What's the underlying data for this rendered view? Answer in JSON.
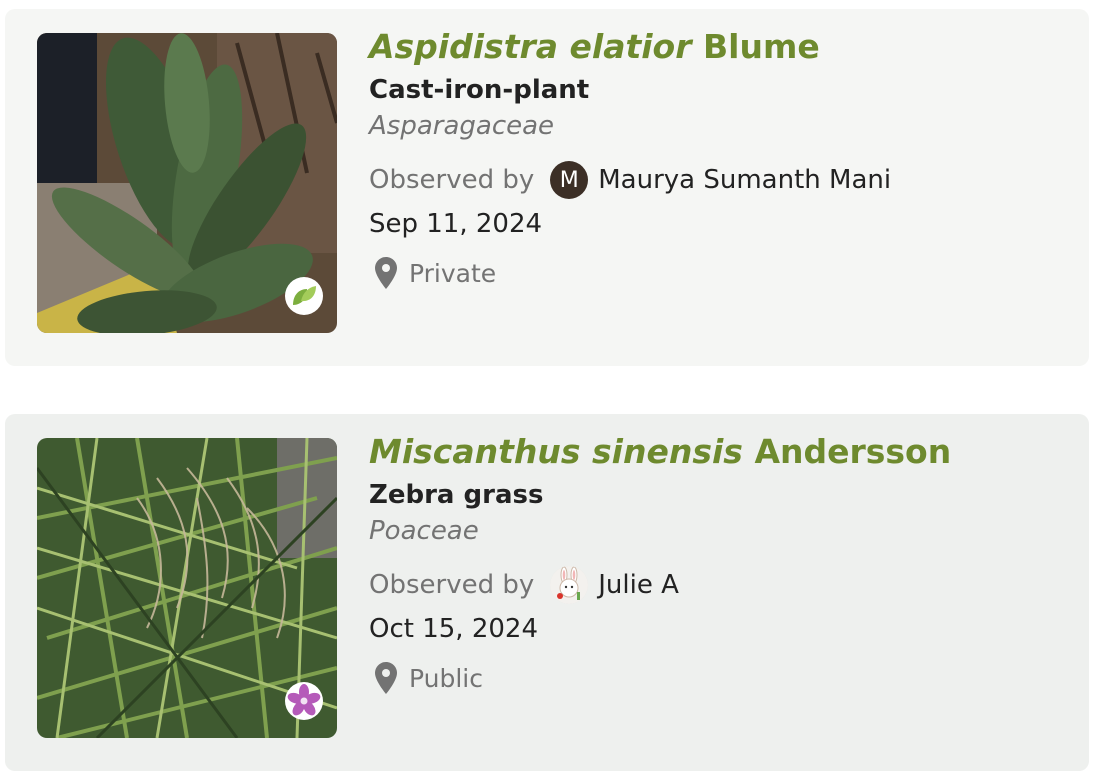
{
  "observations": [
    {
      "genus_species": "Aspidistra elatior",
      "authority": "Blume",
      "common_name": "Cast-iron-plant",
      "family": "Asparagaceae",
      "observed_label": "Observed by",
      "observer_initial": "M",
      "observer": "Maurya Sumanth Mani",
      "date": "Sep 11, 2024",
      "location": "Private",
      "badge_icon": "leaf-icon",
      "colors": {
        "card_bg": "#f5f6f4",
        "name": "#6e8a2e"
      }
    },
    {
      "genus_species": "Miscanthus sinensis",
      "authority": "Andersson",
      "common_name": "Zebra grass",
      "family": "Poaceae",
      "observed_label": "Observed by",
      "observer_avatar_icon": "bunny-avatar-icon",
      "observer": "Julie A",
      "date": "Oct 15, 2024",
      "location": "Public",
      "badge_icon": "flower-icon",
      "colors": {
        "card_bg": "#eef0ee",
        "name": "#6e8a2e"
      }
    }
  ]
}
